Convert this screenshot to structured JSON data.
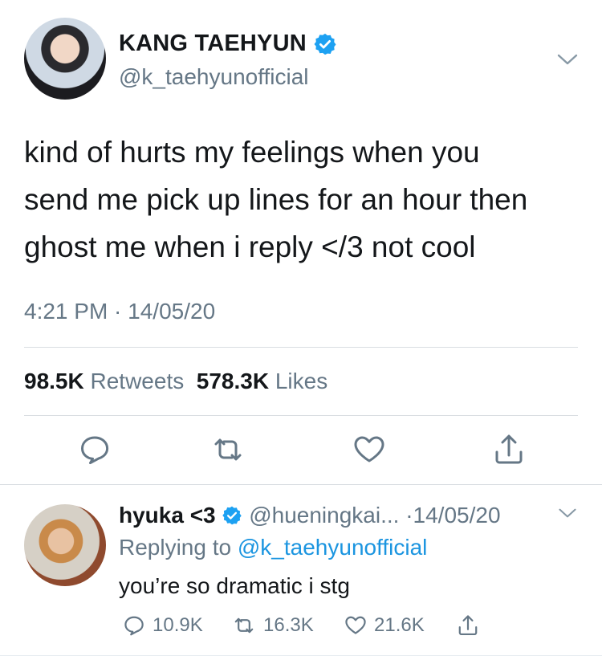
{
  "colors": {
    "verified": "#1da1f2",
    "muted": "#657786",
    "link": "#1b95e0",
    "text": "#14171a"
  },
  "main_tweet": {
    "name": "KANG TAEHYUN",
    "handle": "@k_taehyunofficial",
    "text_lines": [
      "kind of hurts my feelings when you",
      "send me pick up lines for an hour then",
      "ghost me when i reply </3 not cool"
    ],
    "timestamp": "4:21 PM · 14/05/20",
    "retweets_count": "98.5K",
    "retweets_label": "Retweets",
    "likes_count": "578.3K",
    "likes_label": "Likes",
    "icons": [
      "reply-icon",
      "retweet-icon",
      "like-icon",
      "share-icon"
    ]
  },
  "reply": {
    "name": "hyuka <3",
    "handle": "@hueningkai...",
    "date": "·14/05/20",
    "replying_prefix": "Replying to",
    "replying_to": "@k_taehyunofficial",
    "text": "you’re so dramatic i stg",
    "reply_count": "10.9K",
    "retweet_count": "16.3K",
    "like_count": "21.6K"
  }
}
